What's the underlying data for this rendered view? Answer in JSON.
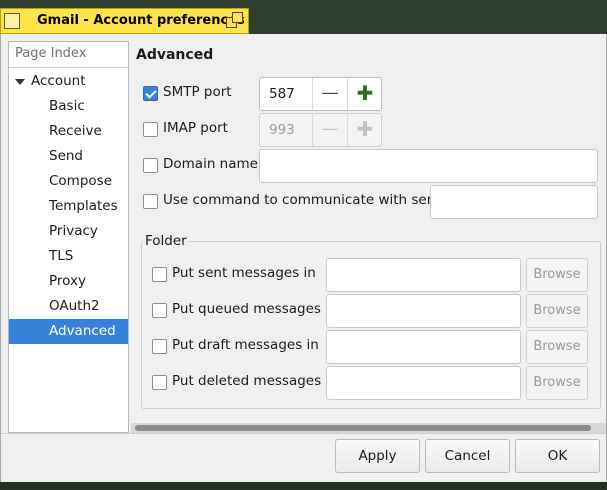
{
  "window": {
    "title": "Gmail - Account preferences"
  },
  "sidebar": {
    "header": "Page Index",
    "root": {
      "label": "Account"
    },
    "items": [
      {
        "label": "Basic"
      },
      {
        "label": "Receive"
      },
      {
        "label": "Send"
      },
      {
        "label": "Compose"
      },
      {
        "label": "Templates"
      },
      {
        "label": "Privacy"
      },
      {
        "label": "TLS"
      },
      {
        "label": "Proxy"
      },
      {
        "label": "OAuth2"
      },
      {
        "label": "Advanced",
        "selected": true
      }
    ]
  },
  "advanced": {
    "title": "Advanced",
    "smtp_port": {
      "label": "SMTP port",
      "checked": true,
      "value": "587"
    },
    "imap_port": {
      "label": "IMAP port",
      "checked": false,
      "value": "993"
    },
    "domain_name": {
      "label": "Domain name",
      "checked": false,
      "value": ""
    },
    "use_command": {
      "label": "Use command to communicate with server",
      "checked": false,
      "value": ""
    }
  },
  "folder": {
    "title": "Folder",
    "rows": [
      {
        "label": "Put sent messages in",
        "browse": "Browse"
      },
      {
        "label": "Put queued messages in",
        "browse": "Browse"
      },
      {
        "label": "Put draft messages in",
        "browse": "Browse"
      },
      {
        "label": "Put deleted messages in",
        "browse": "Browse"
      }
    ]
  },
  "spin_symbols": {
    "minus": "—",
    "plus": "✚"
  },
  "buttons": {
    "apply": "Apply",
    "cancel": "Cancel",
    "ok": "OK"
  },
  "colors": {
    "titlebar": "#ffe34a",
    "selection": "#3483d8"
  }
}
